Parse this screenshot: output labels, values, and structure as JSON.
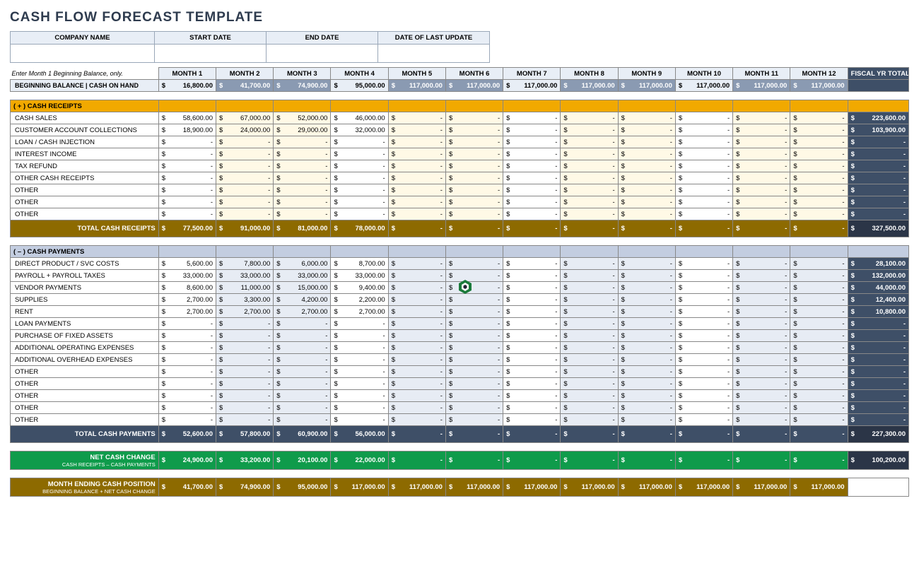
{
  "title": "CASH FLOW FORECAST TEMPLATE",
  "meta_headers": [
    "COMPANY NAME",
    "START DATE",
    "END DATE",
    "DATE OF LAST UPDATE"
  ],
  "note": "Enter Month 1 Beginning Balance, only.",
  "months": [
    "MONTH 1",
    "MONTH 2",
    "MONTH 3",
    "MONTH 4",
    "MONTH 5",
    "MONTH 6",
    "MONTH 7",
    "MONTH 8",
    "MONTH 9",
    "MONTH 10",
    "MONTH 11",
    "MONTH 12"
  ],
  "fiscal_header": "FISCAL YR TOTALS",
  "beginning_label": "BEGINNING BALANCE  |  CASH ON HAND",
  "beginning": [
    "16,800.00",
    "41,700.00",
    "74,900.00",
    "95,000.00",
    "117,000.00",
    "117,000.00",
    "117,000.00",
    "117,000.00",
    "117,000.00",
    "117,000.00",
    "117,000.00",
    "117,000.00"
  ],
  "sections": {
    "receipts": {
      "header": "( + )   CASH RECEIPTS",
      "rows": [
        {
          "label": "CASH SALES",
          "m": [
            "58,600.00",
            "67,000.00",
            "52,000.00",
            "46,000.00",
            "-",
            "-",
            "-",
            "-",
            "-",
            "-",
            "-",
            "-"
          ],
          "f": "223,600.00"
        },
        {
          "label": "CUSTOMER ACCOUNT COLLECTIONS",
          "m": [
            "18,900.00",
            "24,000.00",
            "29,000.00",
            "32,000.00",
            "-",
            "-",
            "-",
            "-",
            "-",
            "-",
            "-",
            "-"
          ],
          "f": "103,900.00"
        },
        {
          "label": "LOAN / CASH INJECTION",
          "m": [
            "-",
            "-",
            "-",
            "-",
            "-",
            "-",
            "-",
            "-",
            "-",
            "-",
            "-",
            "-"
          ],
          "f": "-"
        },
        {
          "label": "INTEREST INCOME",
          "m": [
            "-",
            "-",
            "-",
            "-",
            "-",
            "-",
            "-",
            "-",
            "-",
            "-",
            "-",
            "-"
          ],
          "f": "-"
        },
        {
          "label": "TAX REFUND",
          "m": [
            "-",
            "-",
            "-",
            "-",
            "-",
            "-",
            "-",
            "-",
            "-",
            "-",
            "-",
            "-"
          ],
          "f": "-"
        },
        {
          "label": "OTHER CASH RECEIPTS",
          "m": [
            "-",
            "-",
            "-",
            "-",
            "-",
            "-",
            "-",
            "-",
            "-",
            "-",
            "-",
            "-"
          ],
          "f": "-"
        },
        {
          "label": "OTHER",
          "m": [
            "-",
            "-",
            "-",
            "-",
            "-",
            "-",
            "-",
            "-",
            "-",
            "-",
            "-",
            "-"
          ],
          "f": "-"
        },
        {
          "label": "OTHER",
          "m": [
            "-",
            "-",
            "-",
            "-",
            "-",
            "-",
            "-",
            "-",
            "-",
            "-",
            "-",
            "-"
          ],
          "f": "-"
        },
        {
          "label": "OTHER",
          "m": [
            "-",
            "-",
            "-",
            "-",
            "-",
            "-",
            "-",
            "-",
            "-",
            "-",
            "-",
            "-"
          ],
          "f": "-"
        }
      ],
      "total": {
        "label": "TOTAL CASH RECEIPTS",
        "m": [
          "77,500.00",
          "91,000.00",
          "81,000.00",
          "78,000.00",
          "-",
          "-",
          "-",
          "-",
          "-",
          "-",
          "-",
          "-"
        ],
        "f": "327,500.00"
      }
    },
    "payments": {
      "header": "( – )   CASH PAYMENTS",
      "rows": [
        {
          "label": "DIRECT PRODUCT / SVC COSTS",
          "m": [
            "5,600.00",
            "7,800.00",
            "6,000.00",
            "8,700.00",
            "-",
            "-",
            "-",
            "-",
            "-",
            "-",
            "-",
            "-"
          ],
          "f": "28,100.00"
        },
        {
          "label": "PAYROLL + PAYROLL TAXES",
          "m": [
            "33,000.00",
            "33,000.00",
            "33,000.00",
            "33,000.00",
            "-",
            "-",
            "-",
            "-",
            "-",
            "-",
            "-",
            "-"
          ],
          "f": "132,000.00"
        },
        {
          "label": "VENDOR PAYMENTS",
          "m": [
            "8,600.00",
            "11,000.00",
            "15,000.00",
            "9,400.00",
            "-",
            "-",
            "-",
            "-",
            "-",
            "-",
            "-",
            "-"
          ],
          "f": "44,000.00"
        },
        {
          "label": "SUPPLIES",
          "m": [
            "2,700.00",
            "3,300.00",
            "4,200.00",
            "2,200.00",
            "-",
            "-",
            "-",
            "-",
            "-",
            "-",
            "-",
            "-"
          ],
          "f": "12,400.00"
        },
        {
          "label": "RENT",
          "m": [
            "2,700.00",
            "2,700.00",
            "2,700.00",
            "2,700.00",
            "-",
            "-",
            "-",
            "-",
            "-",
            "-",
            "-",
            "-"
          ],
          "f": "10,800.00"
        },
        {
          "label": "LOAN PAYMENTS",
          "m": [
            "-",
            "-",
            "-",
            "-",
            "-",
            "-",
            "-",
            "-",
            "-",
            "-",
            "-",
            "-"
          ],
          "f": "-"
        },
        {
          "label": "PURCHASE OF FIXED ASSETS",
          "m": [
            "-",
            "-",
            "-",
            "-",
            "-",
            "-",
            "-",
            "-",
            "-",
            "-",
            "-",
            "-"
          ],
          "f": "-"
        },
        {
          "label": "ADDITIONAL OPERATING EXPENSES",
          "m": [
            "-",
            "-",
            "-",
            "-",
            "-",
            "-",
            "-",
            "-",
            "-",
            "-",
            "-",
            "-"
          ],
          "f": "-"
        },
        {
          "label": "ADDITIONAL OVERHEAD EXPENSES",
          "m": [
            "-",
            "-",
            "-",
            "-",
            "-",
            "-",
            "-",
            "-",
            "-",
            "-",
            "-",
            "-"
          ],
          "f": "-"
        },
        {
          "label": "OTHER",
          "m": [
            "-",
            "-",
            "-",
            "-",
            "-",
            "-",
            "-",
            "-",
            "-",
            "-",
            "-",
            "-"
          ],
          "f": "-"
        },
        {
          "label": "OTHER",
          "m": [
            "-",
            "-",
            "-",
            "-",
            "-",
            "-",
            "-",
            "-",
            "-",
            "-",
            "-",
            "-"
          ],
          "f": "-"
        },
        {
          "label": "OTHER",
          "m": [
            "-",
            "-",
            "-",
            "-",
            "-",
            "-",
            "-",
            "-",
            "-",
            "-",
            "-",
            "-"
          ],
          "f": "-"
        },
        {
          "label": "OTHER",
          "m": [
            "-",
            "-",
            "-",
            "-",
            "-",
            "-",
            "-",
            "-",
            "-",
            "-",
            "-",
            "-"
          ],
          "f": "-"
        },
        {
          "label": "OTHER",
          "m": [
            "-",
            "-",
            "-",
            "-",
            "-",
            "-",
            "-",
            "-",
            "-",
            "-",
            "-",
            "-"
          ],
          "f": "-"
        }
      ],
      "total": {
        "label": "TOTAL CASH PAYMENTS",
        "m": [
          "52,600.00",
          "57,800.00",
          "60,900.00",
          "56,000.00",
          "-",
          "-",
          "-",
          "-",
          "-",
          "-",
          "-",
          "-"
        ],
        "f": "227,300.00"
      }
    }
  },
  "net": {
    "label": "NET CASH CHANGE",
    "sub": "CASH RECEIPTS – CASH PAYMENTS",
    "m": [
      "24,900.00",
      "33,200.00",
      "20,100.00",
      "22,000.00",
      "-",
      "-",
      "-",
      "-",
      "-",
      "-",
      "-",
      "-"
    ],
    "f": "100,200.00"
  },
  "ending": {
    "label": "MONTH ENDING CASH POSITION",
    "sub": "BEGINNING BALANCE + NET CASH CHANGE",
    "m": [
      "41,700.00",
      "74,900.00",
      "95,000.00",
      "117,000.00",
      "117,000.00",
      "117,000.00",
      "117,000.00",
      "117,000.00",
      "117,000.00",
      "117,000.00",
      "117,000.00",
      "117,000.00"
    ],
    "f": ""
  }
}
